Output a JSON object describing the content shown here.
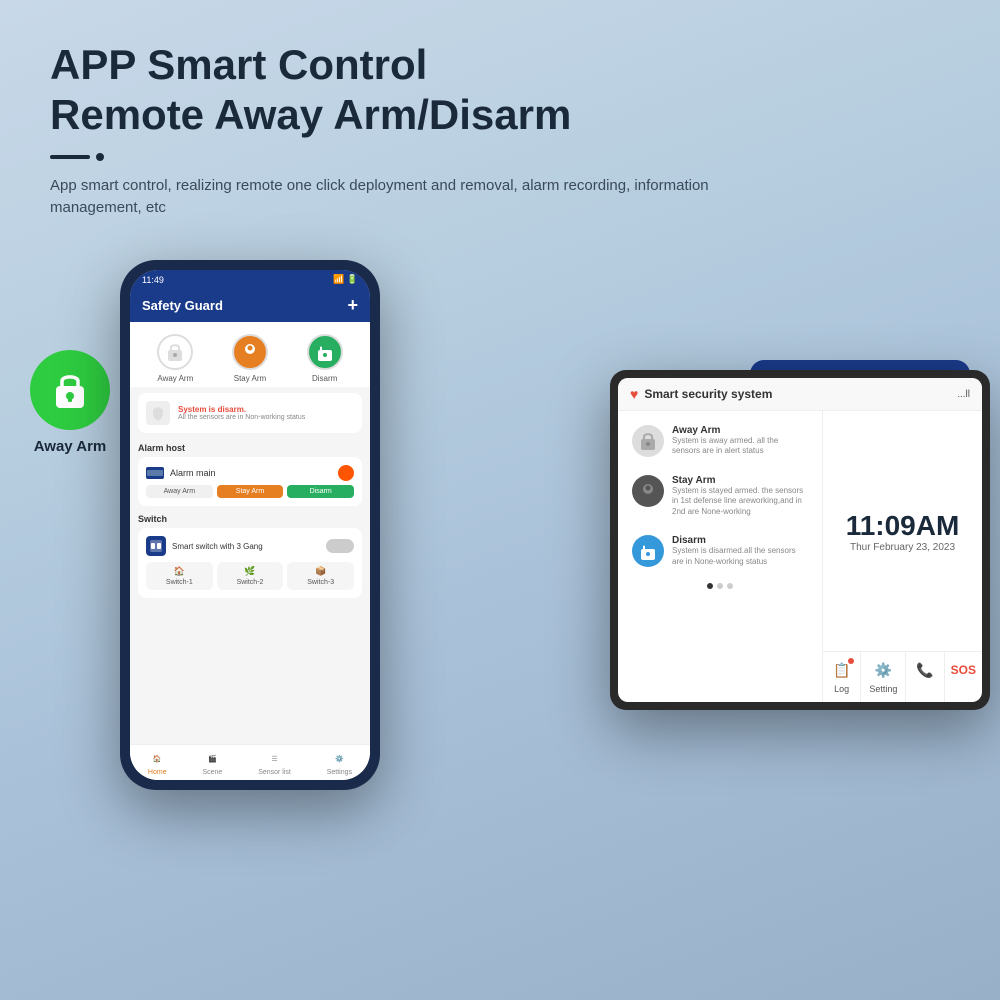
{
  "header": {
    "title_line1": "APP Smart Control",
    "title_line2": "Remote Away Arm/Disarm",
    "subtitle": "App smart control, realizing remote one click deployment and removal, alarm recording, information management, etc",
    "decoration_line": "——",
    "decoration_dot": "·"
  },
  "icons": {
    "away_arm_label": "Away Arm",
    "stay_arm_label": "Stay Arm",
    "disarm_label": "Disarm",
    "safety_guard_label": "Safety Guard"
  },
  "phone": {
    "status_time": "11:49",
    "title": "Safety Guard",
    "add_button": "+",
    "arm_away": "Away Arm",
    "arm_stay": "Stay Arm",
    "arm_disarm": "Disarm",
    "status_text": "System is disarm.",
    "status_sub": "All the sensors are in Non-working status",
    "section_alarm": "Alarm host",
    "device_name": "Alarm main",
    "btn_away": "Away Arm",
    "btn_stay": "Stay Arm",
    "btn_disarm": "Disarm",
    "section_switch": "Switch",
    "switch_name": "Smart switch with 3 Gang",
    "switch1": "Switch-1",
    "switch2": "Switch-2",
    "switch3": "Switch-3",
    "nav_home": "Home",
    "nav_scene": "Scene",
    "nav_sensor": "Sensor list",
    "nav_settings": "Settings"
  },
  "tablet": {
    "title": "Smart security system",
    "signal": "...ll",
    "away_arm_title": "Away Arm",
    "away_arm_desc": "System is away armed. all the sensors are in alert status",
    "stay_arm_title": "Stay Arm",
    "stay_arm_desc": "System is stayed armed. the sensors in 1st defense line areworking,and in 2nd are None-working",
    "disarm_title": "Disarm",
    "disarm_desc": "System is disarmed.all the sensors are in None-working status",
    "time": "11:09AM",
    "date": "Thur February 23, 2023",
    "log_label": "Log",
    "settings_label": "Setting",
    "phone_label": "SOS"
  },
  "colors": {
    "green": "#2ecc40",
    "orange": "#e67e22",
    "red": "#e74c3c",
    "navy": "#1a3a8a",
    "dark": "#1a2a3a"
  }
}
